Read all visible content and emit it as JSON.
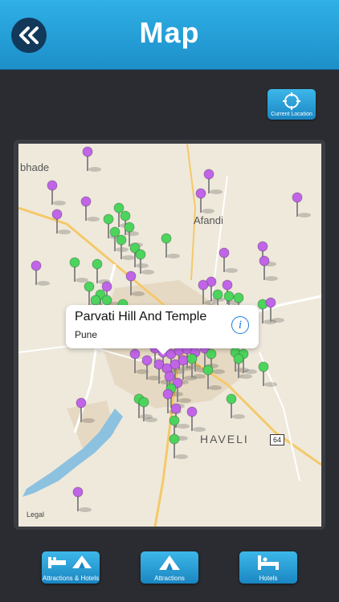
{
  "header": {
    "title": "Map"
  },
  "controls": {
    "current_location_label": "Current Location"
  },
  "map": {
    "labels": {
      "place_top_left": "bhade",
      "place_afandi": "Afandi",
      "place_haveli": "HAVELI",
      "road_64": "64",
      "legal": "Legal"
    }
  },
  "callout": {
    "title": "Parvati Hill And Temple",
    "subtitle": "Pune"
  },
  "tabs": [
    {
      "label": "Attractions & Hotels"
    },
    {
      "label": "Attractions"
    },
    {
      "label": "Hotels"
    }
  ],
  "colors": {
    "header": "#1d8fc9",
    "pin_green": "#4cd45d",
    "pin_purple": "#c064e8",
    "button": "#1a86c2"
  }
}
